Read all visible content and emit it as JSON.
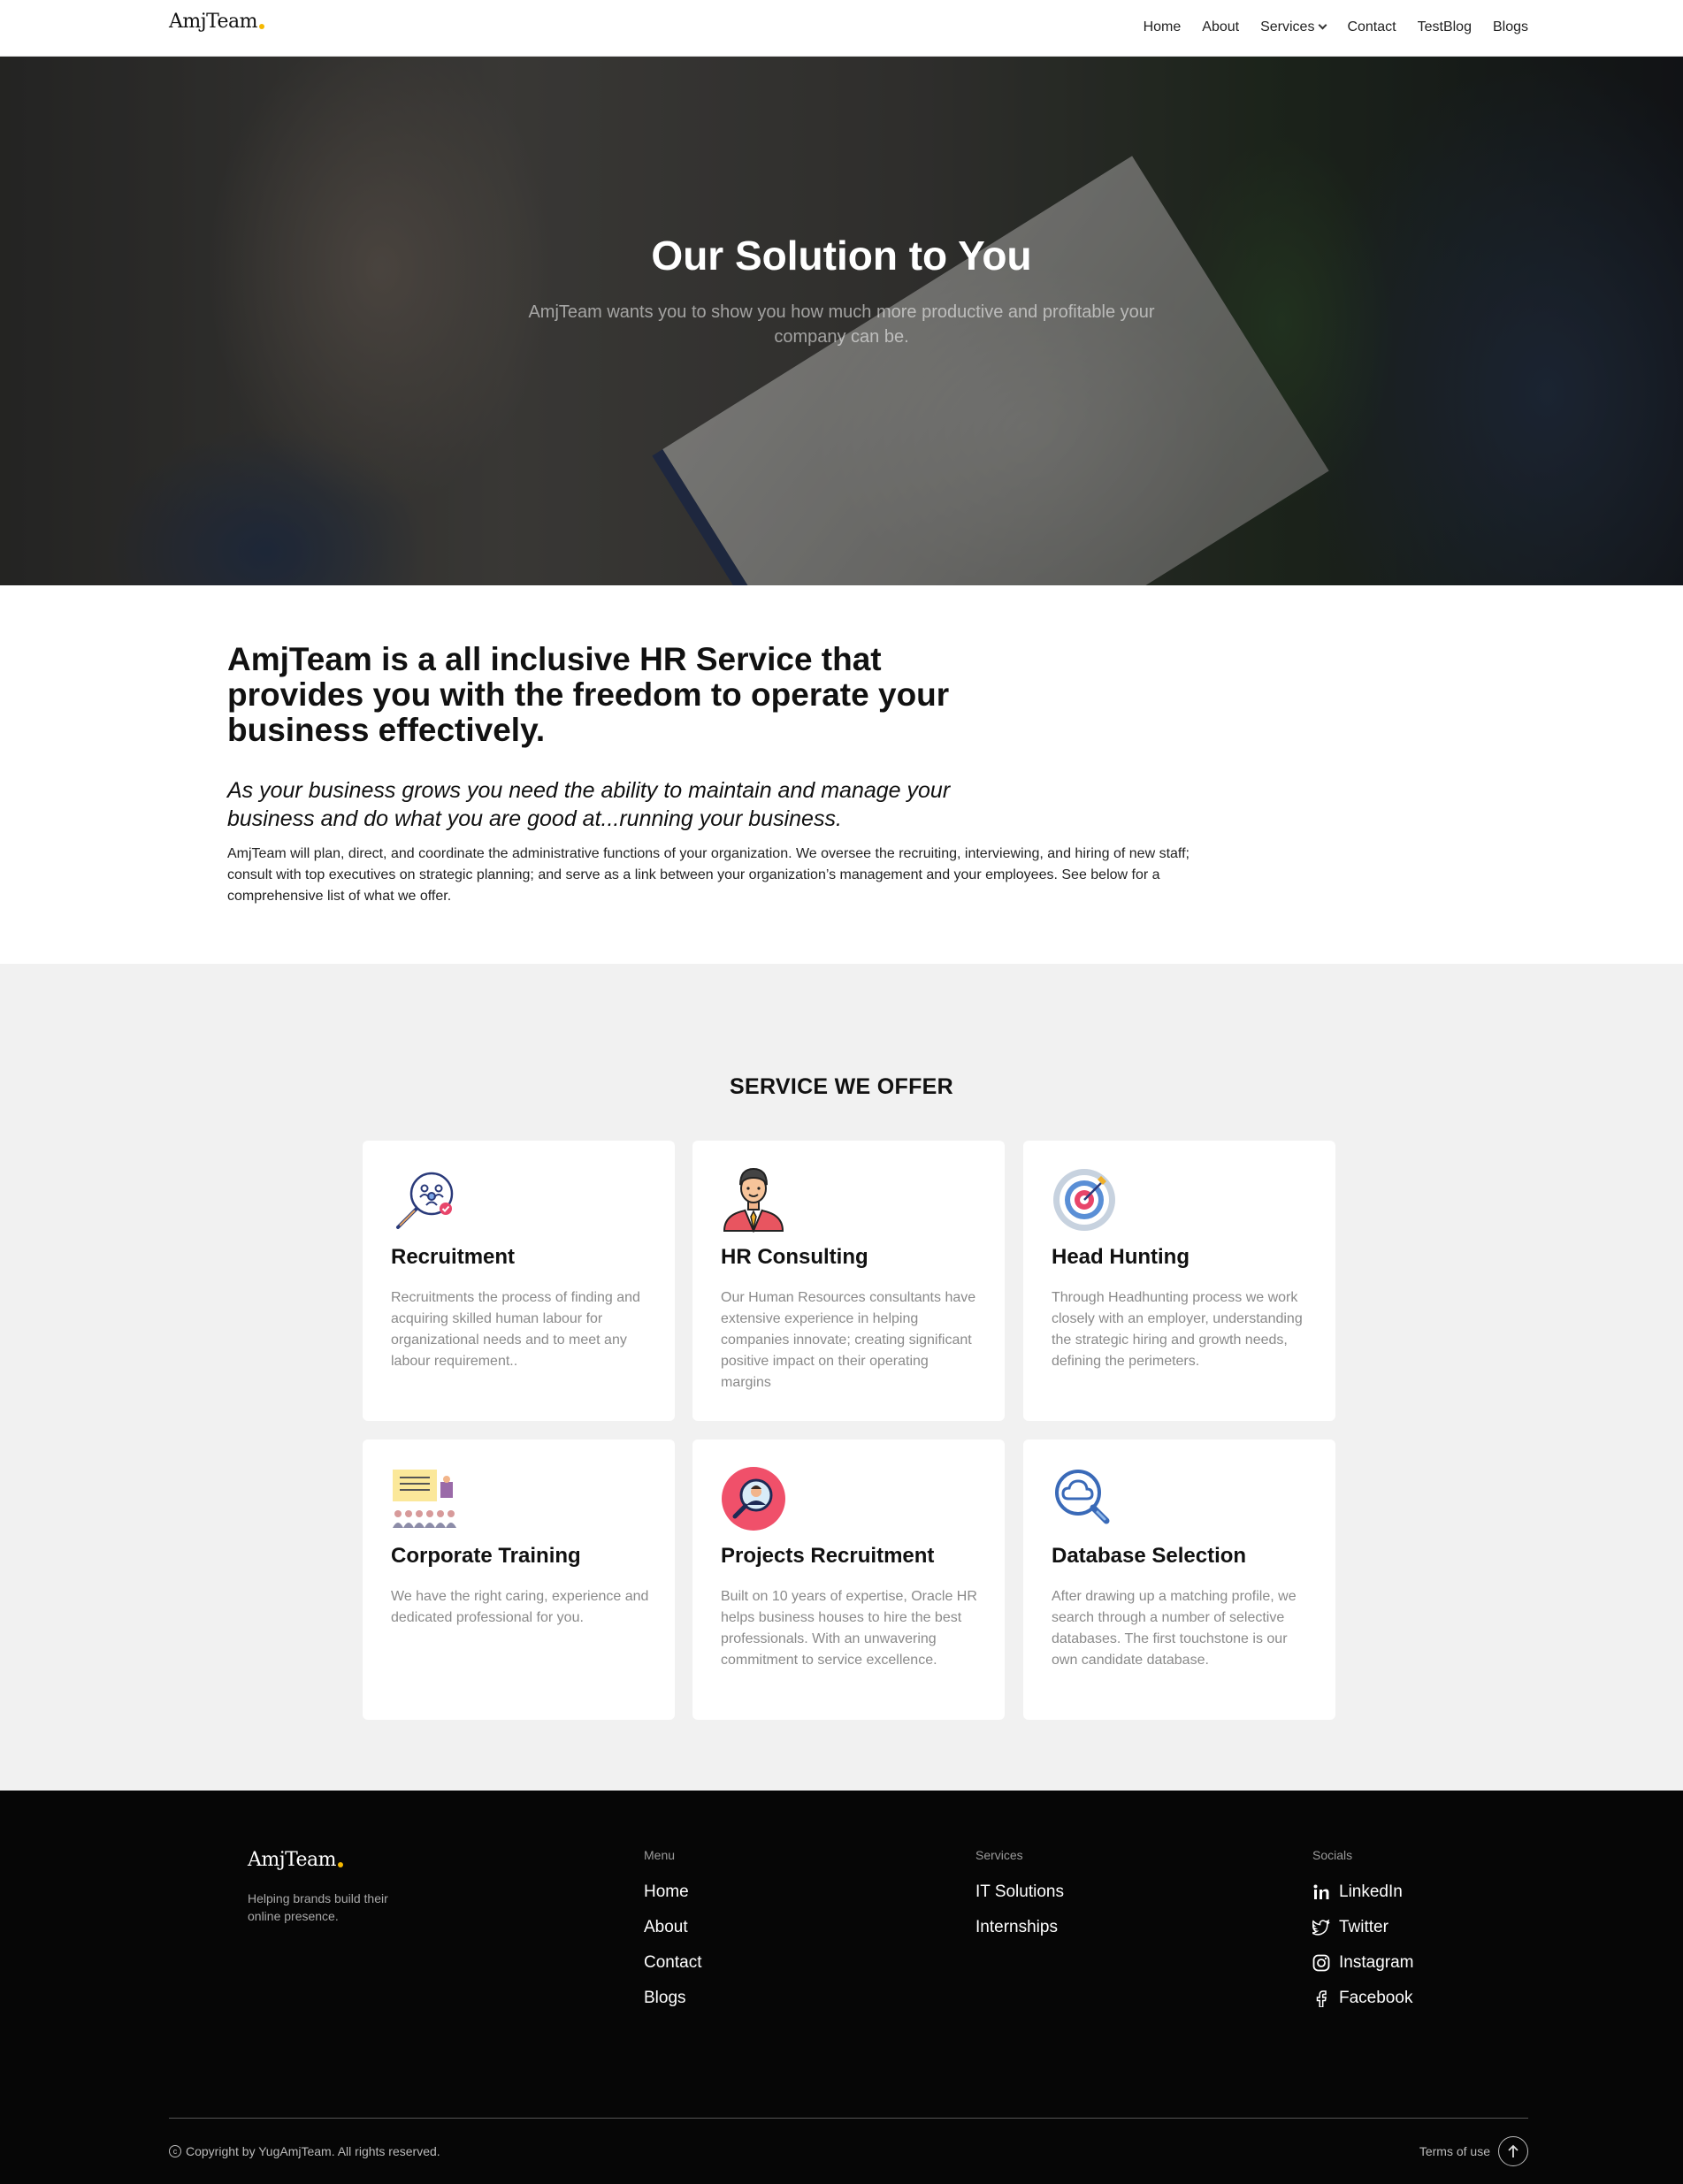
{
  "nav": {
    "logo": "AmjTeam",
    "links": [
      "Home",
      "About",
      "Services",
      "Contact",
      "TestBlog",
      "Blogs"
    ]
  },
  "hero": {
    "title": "Our Solution to You",
    "subtitle": "AmjTeam wants you to show you how much more productive and profitable your company can be."
  },
  "intro": {
    "heading": "AmjTeam is a all inclusive HR Service that provides you with the freedom to operate your business effectively.",
    "subheading": "As your business grows you need the ability to maintain and manage your business and do what you are good at...running your business.",
    "body": "AmjTeam will plan, direct, and coordinate the administrative functions of your organization. We oversee the recruiting, interviewing, and hiring of new staff; consult with top executives on strategic planning; and serve as a link between your organization’s management and your employees. See below for a comprehensive list of what we offer."
  },
  "services": {
    "title": "SERVICE WE OFFER",
    "cards": [
      {
        "title": "Recruitment",
        "icon": "recruitment-icon",
        "text": "Recruitments the process of finding and acquiring skilled human labour for organizational needs and to meet any labour requirement.."
      },
      {
        "title": "HR Consulting",
        "icon": "hr-consultant-icon",
        "text": "Our Human Resources consultants have extensive experience in helping companies innovate; creating significant positive impact on their operating margins"
      },
      {
        "title": "Head Hunting",
        "icon": "target-icon",
        "text": "Through Headhunting process we work closely with an employer, understanding the strategic hiring and growth needs, defining the perimeters."
      },
      {
        "title": "Corporate Training",
        "icon": "training-icon",
        "text": "We have the right caring, experience and dedicated professional for you."
      },
      {
        "title": "Projects Recruitment",
        "icon": "candidate-search-icon",
        "text": "Built on 10 years of expertise, Oracle HR helps business houses to hire the best professionals. With an unwavering commitment to service excellence."
      },
      {
        "title": "Database Selection",
        "icon": "cloud-search-icon",
        "text": "After drawing up a matching profile, we search through a number of selective databases. The first touchstone is our own candidate database."
      }
    ]
  },
  "footer": {
    "logo": "AmjTeam",
    "tagline": "Helping brands build their online presence.",
    "menu_head": "Menu",
    "menu": [
      "Home",
      "About",
      "Contact",
      "Blogs"
    ],
    "services_head": "Services",
    "services": [
      "IT Solutions",
      "Internships"
    ],
    "socials_head": "Socials",
    "socials": [
      "LinkedIn",
      "Twitter",
      "Instagram",
      "Facebook"
    ],
    "copyright": "Copyright by YugAmjTeam. All rights reserved.",
    "terms": "Terms of use"
  },
  "colors": {
    "accent_dot": "#f5b800",
    "services_bg": "#f1f1f1",
    "footer_bg": "#060606"
  }
}
